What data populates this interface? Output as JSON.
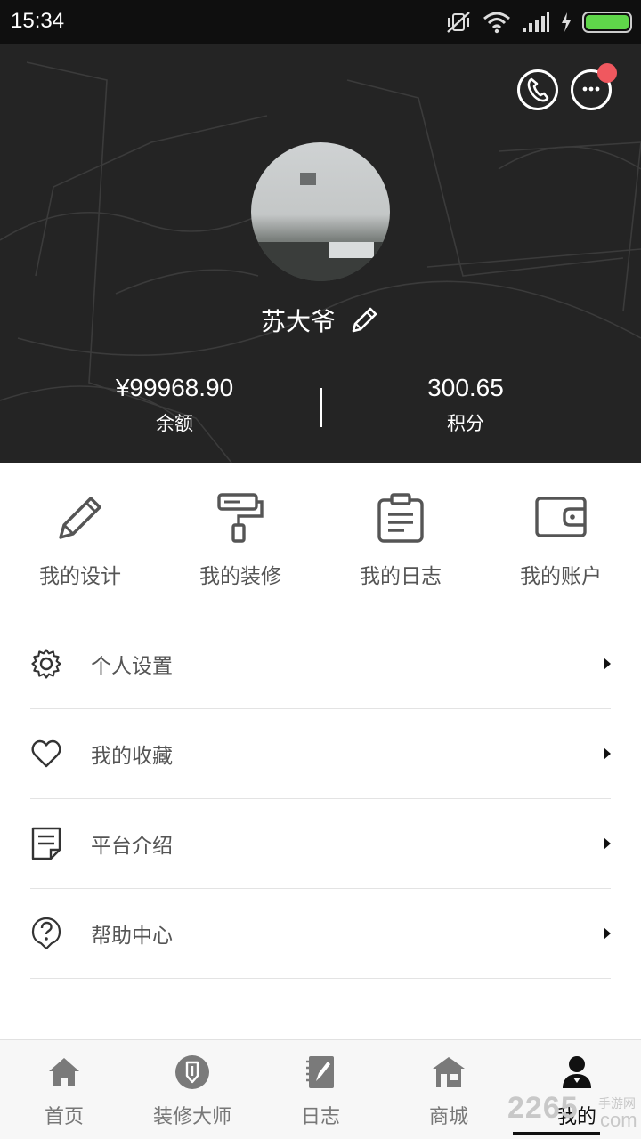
{
  "status_bar": {
    "time": "15:34",
    "icons": [
      "mute-vibrate-icon",
      "wifi-icon",
      "signal-icon",
      "charging-icon",
      "battery-icon"
    ],
    "battery_color": "#5fd64a"
  },
  "header": {
    "background_color": "#242424",
    "actions": [
      "phone-icon",
      "chat-icon"
    ],
    "chat_badge_color": "#f0585f",
    "username": "苏大爷",
    "stats": [
      {
        "value": "¥99968.90",
        "label": "余额"
      },
      {
        "value": "300.65",
        "label": "积分"
      }
    ]
  },
  "quick_actions": [
    {
      "label": "我的设计",
      "icon": "pencil-icon"
    },
    {
      "label": "我的装修",
      "icon": "paint-roller-icon"
    },
    {
      "label": "我的日志",
      "icon": "clipboard-icon"
    },
    {
      "label": "我的账户",
      "icon": "wallet-icon"
    }
  ],
  "menu": [
    {
      "label": "个人设置",
      "icon": "gear-icon"
    },
    {
      "label": "我的收藏",
      "icon": "heart-icon"
    },
    {
      "label": "平台介绍",
      "icon": "document-icon"
    },
    {
      "label": "帮助中心",
      "icon": "help-icon"
    }
  ],
  "tabbar": {
    "active_index": 4,
    "tabs": [
      {
        "label": "首页",
        "icon": "home-icon"
      },
      {
        "label": "装修大师",
        "icon": "master-icon"
      },
      {
        "label": "日志",
        "icon": "notebook-icon"
      },
      {
        "label": "商城",
        "icon": "shop-icon"
      },
      {
        "label": "我的",
        "icon": "user-icon"
      }
    ]
  },
  "watermark": {
    "number": "2265",
    "small": "手游网",
    "com": "com"
  }
}
